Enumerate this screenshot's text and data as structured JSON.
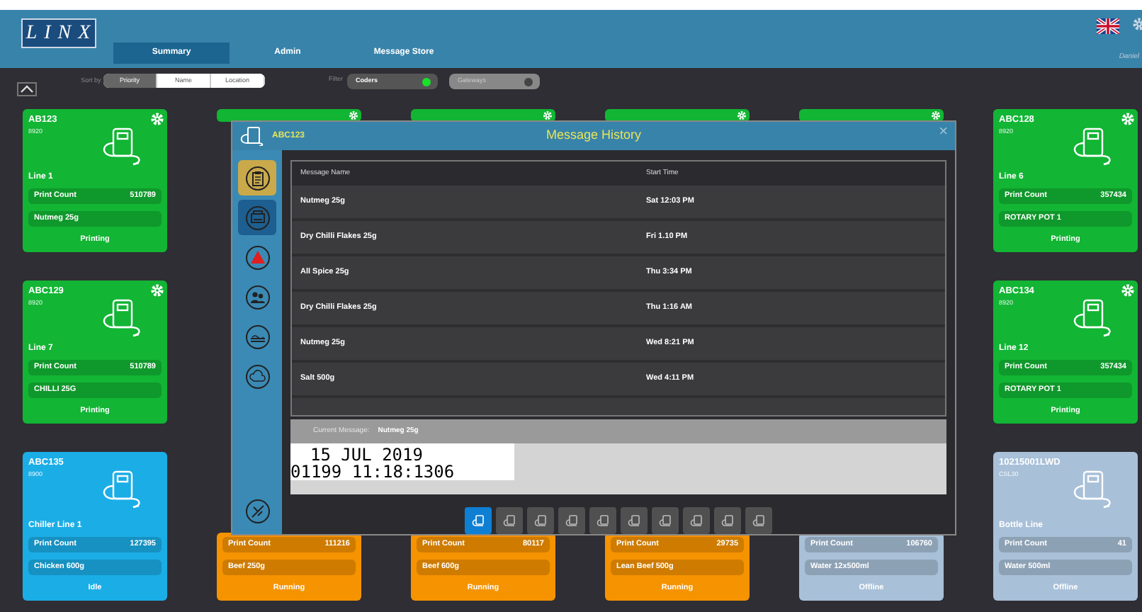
{
  "header": {
    "logo": "LINX",
    "tabs": [
      {
        "label": "Summary",
        "selected": true
      },
      {
        "label": "Admin",
        "selected": false
      },
      {
        "label": "Message Store",
        "selected": false
      }
    ],
    "user": "Daniel"
  },
  "toolbar": {
    "sort_label": "Sort by",
    "sort_options": [
      {
        "label": "Priority",
        "selected": true
      },
      {
        "label": "Name",
        "selected": false
      },
      {
        "label": "Location",
        "selected": false
      }
    ],
    "filter_label": "Filter",
    "filters": [
      {
        "label": "Coders",
        "on": true
      },
      {
        "label": "Gateways",
        "on": false
      }
    ]
  },
  "card_rows": [
    [
      {
        "color": "#12b534",
        "settings": true,
        "id": "AB123",
        "model": "8920",
        "line": "Line 1",
        "count_label": "Print Count",
        "count": "510789",
        "product": "Nutmeg 25g",
        "status": "Printing"
      },
      {
        "color": "#12b534",
        "settings": true
      },
      {
        "color": "#12b534",
        "settings": true
      },
      {
        "color": "#12b534",
        "settings": true
      },
      {
        "color": "#12b534",
        "settings": true
      },
      {
        "color": "#12b534",
        "settings": true,
        "id": "ABC128",
        "model": "8920",
        "line": "Line 6",
        "count_label": "Print Count",
        "count": "357434",
        "product": "ROTARY POT 1",
        "status": "Printing"
      }
    ],
    [
      {
        "color": "#12b534",
        "settings": true,
        "id": "ABC129",
        "model": "8920",
        "line": "Line 7",
        "count_label": "Print Count",
        "count": "510789",
        "product": "CHILLI 25G",
        "status": "Printing"
      },
      {
        "color": "#12b534",
        "settings": true,
        "id": "ABC134",
        "model": "8920",
        "line": "Line 12",
        "count_label": "Print Count",
        "count": "357434",
        "product": "ROTARY POT 1",
        "status": "Printing"
      }
    ],
    [
      {
        "color": "#1bade6",
        "settings": false,
        "id": "ABC135",
        "model": "8900",
        "line": "Chiller Line 1",
        "count_label": "Print Count",
        "count": "127395",
        "product": "Chicken 600g",
        "status": "Idle"
      },
      {
        "color": "#f69300",
        "settings": false,
        "count_label": "Print Count",
        "count": "111216",
        "product": "Beef 250g",
        "status": "Running"
      },
      {
        "color": "#f69300",
        "settings": false,
        "count_label": "Print Count",
        "count": "80117",
        "product": "Beef 600g",
        "status": "Running"
      },
      {
        "color": "#f69300",
        "settings": false,
        "count_label": "Print Count",
        "count": "29735",
        "product": "Lean Beef 500g",
        "status": "Running"
      },
      {
        "color": "#a8c0d8",
        "settings": false,
        "count_label": "Print Count",
        "count": "106760",
        "product": "Water 12x500ml",
        "status": "Offline"
      },
      {
        "color": "#a8c0d8",
        "settings": false,
        "id": "10215001LWD",
        "model": "CSL30",
        "line": "Bottle Line",
        "count_label": "Print Count",
        "count": "41",
        "product": "Water 500ml",
        "status": "Offline"
      }
    ]
  ],
  "dialog": {
    "device": "ABC123",
    "title": "Message History",
    "close": "×",
    "side_items": [
      {
        "kind": "clipboard",
        "color": "#c9a94a"
      },
      {
        "kind": "printer",
        "color": "#1d5f90"
      },
      {
        "kind": "warning"
      },
      {
        "kind": "people"
      },
      {
        "kind": "ink"
      },
      {
        "kind": "cloud"
      },
      {
        "kind": "network"
      }
    ],
    "table": {
      "columns": [
        "Message Name",
        "Start Time"
      ],
      "rows": [
        [
          "Nutmeg 25g",
          "Sat 12:03 PM"
        ],
        [
          "Dry Chilli Flakes 25g",
          "Fri 1.10 PM"
        ],
        [
          "All Spice 25g",
          "Thu 3:34 PM"
        ],
        [
          "Dry Chilli Flakes 25g",
          "Thu 1:16 AM"
        ],
        [
          "Nutmeg 25g",
          "Wed 8:21 PM"
        ],
        [
          "Salt 500g",
          "Wed 4:11 PM"
        ]
      ]
    },
    "current_label": "Current Message:",
    "current_value": "Nutmeg 25g",
    "preview": [
      "15 JUL 2019",
      "01199 11:18:1306"
    ],
    "pager": [
      {
        "selected": true
      },
      {
        "selected": false
      },
      {
        "selected": false
      },
      {
        "selected": false
      },
      {
        "selected": false
      },
      {
        "selected": false
      },
      {
        "selected": false
      },
      {
        "selected": false
      },
      {
        "selected": false
      },
      {
        "selected": false
      }
    ]
  }
}
